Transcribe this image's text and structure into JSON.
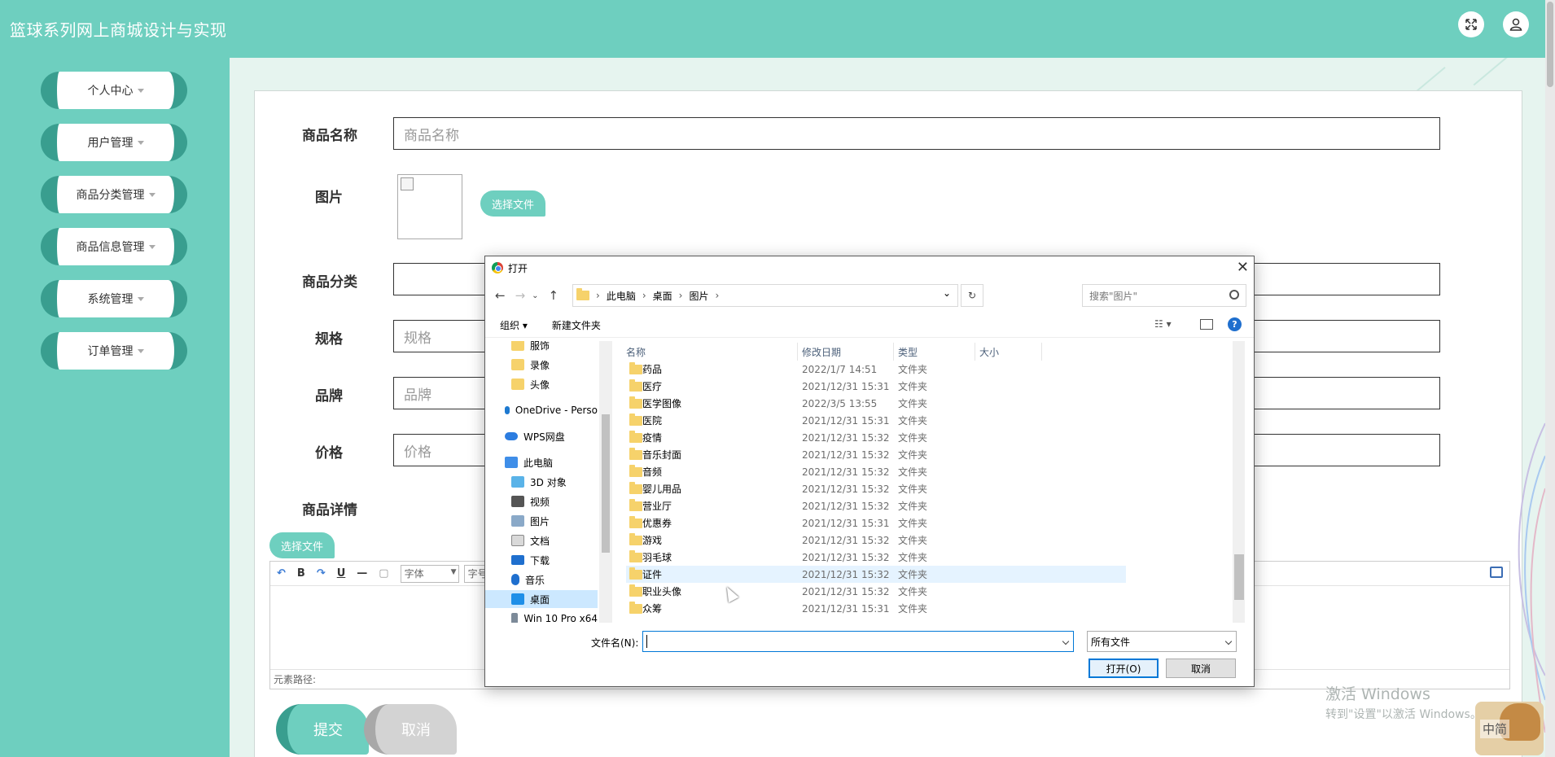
{
  "app": {
    "title": "篮球系列网上商城设计与实现"
  },
  "header_icons": {
    "fullscreen": "fullscreen-icon",
    "user": "user-icon"
  },
  "sidebar": {
    "items": [
      {
        "label": "个人中心"
      },
      {
        "label": "用户管理"
      },
      {
        "label": "商品分类管理"
      },
      {
        "label": "商品信息管理"
      },
      {
        "label": "系统管理"
      },
      {
        "label": "订单管理"
      }
    ]
  },
  "form": {
    "name": {
      "label": "商品名称",
      "placeholder": "商品名称"
    },
    "image": {
      "label": "图片",
      "button": "选择文件"
    },
    "category": {
      "label": "商品分类",
      "value": ""
    },
    "spec": {
      "label": "规格",
      "placeholder": "规格"
    },
    "brand": {
      "label": "品牌",
      "placeholder": "品牌"
    },
    "price": {
      "label": "价格",
      "placeholder": "价格"
    },
    "detail": {
      "label": "商品详情",
      "button": "选择文件"
    },
    "submit": "提交",
    "cancel": "取消"
  },
  "editor": {
    "toolbar": {
      "bold": "B",
      "underline": "U",
      "font": "字体",
      "size": "字号"
    },
    "status": "元素路径:"
  },
  "dialog": {
    "title": "打开",
    "breadcrumb": [
      "此电脑",
      "桌面",
      "图片"
    ],
    "search_placeholder": "搜索\"图片\"",
    "organize": "组织",
    "new_folder": "新建文件夹",
    "nav_items": [
      {
        "label": "服饰",
        "icon": "folder-icon"
      },
      {
        "label": "录像",
        "icon": "folder-icon"
      },
      {
        "label": "头像",
        "icon": "folder-icon"
      },
      {
        "label": "OneDrive - Perso",
        "icon": "cloud-icon"
      },
      {
        "label": "WPS网盘",
        "icon": "cloud-icon"
      },
      {
        "label": "此电脑",
        "icon": "computer-icon"
      },
      {
        "label": "3D 对象",
        "icon": "cube-icon"
      },
      {
        "label": "视频",
        "icon": "video-icon"
      },
      {
        "label": "图片",
        "icon": "picture-icon"
      },
      {
        "label": "文档",
        "icon": "document-icon"
      },
      {
        "label": "下载",
        "icon": "download-icon"
      },
      {
        "label": "音乐",
        "icon": "music-icon"
      },
      {
        "label": "桌面",
        "icon": "desktop-icon"
      },
      {
        "label": "Win 10 Pro x64",
        "icon": "drive-icon"
      }
    ],
    "columns": [
      "名称",
      "修改日期",
      "类型",
      "大小"
    ],
    "rows": [
      {
        "name": "药品",
        "date": "2022/1/7 14:51",
        "type": "文件夹"
      },
      {
        "name": "医疗",
        "date": "2021/12/31 15:31",
        "type": "文件夹"
      },
      {
        "name": "医学图像",
        "date": "2022/3/5 13:55",
        "type": "文件夹"
      },
      {
        "name": "医院",
        "date": "2021/12/31 15:31",
        "type": "文件夹"
      },
      {
        "name": "疫情",
        "date": "2021/12/31 15:32",
        "type": "文件夹"
      },
      {
        "name": "音乐封面",
        "date": "2021/12/31 15:32",
        "type": "文件夹"
      },
      {
        "name": "音频",
        "date": "2021/12/31 15:32",
        "type": "文件夹"
      },
      {
        "name": "婴儿用品",
        "date": "2021/12/31 15:32",
        "type": "文件夹"
      },
      {
        "name": "营业厅",
        "date": "2021/12/31 15:32",
        "type": "文件夹"
      },
      {
        "name": "优惠券",
        "date": "2021/12/31 15:31",
        "type": "文件夹"
      },
      {
        "name": "游戏",
        "date": "2021/12/31 15:32",
        "type": "文件夹"
      },
      {
        "name": "羽毛球",
        "date": "2021/12/31 15:32",
        "type": "文件夹"
      },
      {
        "name": "证件",
        "date": "2021/12/31 15:32",
        "type": "文件夹"
      },
      {
        "name": "职业头像",
        "date": "2021/12/31 15:32",
        "type": "文件夹"
      },
      {
        "name": "众筹",
        "date": "2021/12/31 15:31",
        "type": "文件夹"
      }
    ],
    "filename_label": "文件名(N):",
    "filename_value": "",
    "filetype": "所有文件",
    "open": "打开(O)",
    "cancel": "取消"
  },
  "watermark": {
    "line1": "激活 Windows",
    "line2": "转到\"设置\"以激活 Windows。"
  },
  "ime": {
    "label": "中简"
  }
}
